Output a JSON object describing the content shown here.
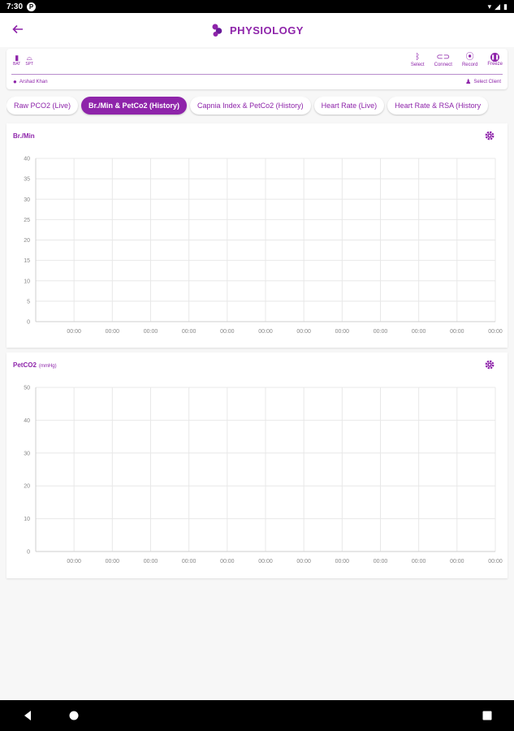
{
  "status_bar": {
    "time": "7:30",
    "app_badge": "P"
  },
  "app_bar": {
    "title": "PHYSIOLOGY"
  },
  "device_bar": {
    "stats": [
      {
        "label": "BAT",
        "icon": "battery-icon"
      },
      {
        "label": "SPT",
        "icon": "sensor-icon"
      }
    ],
    "actions": [
      {
        "label": "Select",
        "icon": "bluetooth-icon"
      },
      {
        "label": "Connect",
        "icon": "link-icon"
      },
      {
        "label": "Record",
        "icon": "record-icon"
      },
      {
        "label": "Freeze",
        "icon": "pause-icon"
      }
    ],
    "user_name": "Arshad Khan",
    "select_client": "Select Client"
  },
  "tabs": [
    {
      "label": "Raw PCO2 (Live)",
      "active": false
    },
    {
      "label": "Br./Min & PetCo2 (History)",
      "active": true
    },
    {
      "label": "Capnia Index & PetCo2 (History)",
      "active": false
    },
    {
      "label": "Heart Rate (Live)",
      "active": false
    },
    {
      "label": "Heart Rate & RSA (History",
      "active": false
    }
  ],
  "colors": {
    "accent": "#8e24aa",
    "grid": "#e8e8e8",
    "axis_text": "#888888"
  },
  "chart_data": [
    {
      "type": "line",
      "title": "Br./Min",
      "unit": "",
      "ylim": [
        0,
        40
      ],
      "y_ticks": [
        "40",
        "35",
        "30",
        "25",
        "20",
        "15",
        "10",
        "5",
        "0"
      ],
      "x_ticks": [
        "00:00",
        "00:00",
        "00:00",
        "00:00",
        "00:00",
        "00:00",
        "00:00",
        "00:00",
        "00:00",
        "00:00",
        "00:00",
        "00:00"
      ],
      "grid": true,
      "series": []
    },
    {
      "type": "line",
      "title": "PetCO2",
      "unit": "(mmHg)",
      "ylim": [
        0,
        50
      ],
      "y_ticks": [
        "50",
        "40",
        "30",
        "20",
        "10",
        "0"
      ],
      "x_ticks": [
        "00:00",
        "00:00",
        "00:00",
        "00:00",
        "00:00",
        "00:00",
        "00:00",
        "00:00",
        "00:00",
        "00:00",
        "00:00",
        "00:00"
      ],
      "grid": true,
      "series": []
    }
  ]
}
